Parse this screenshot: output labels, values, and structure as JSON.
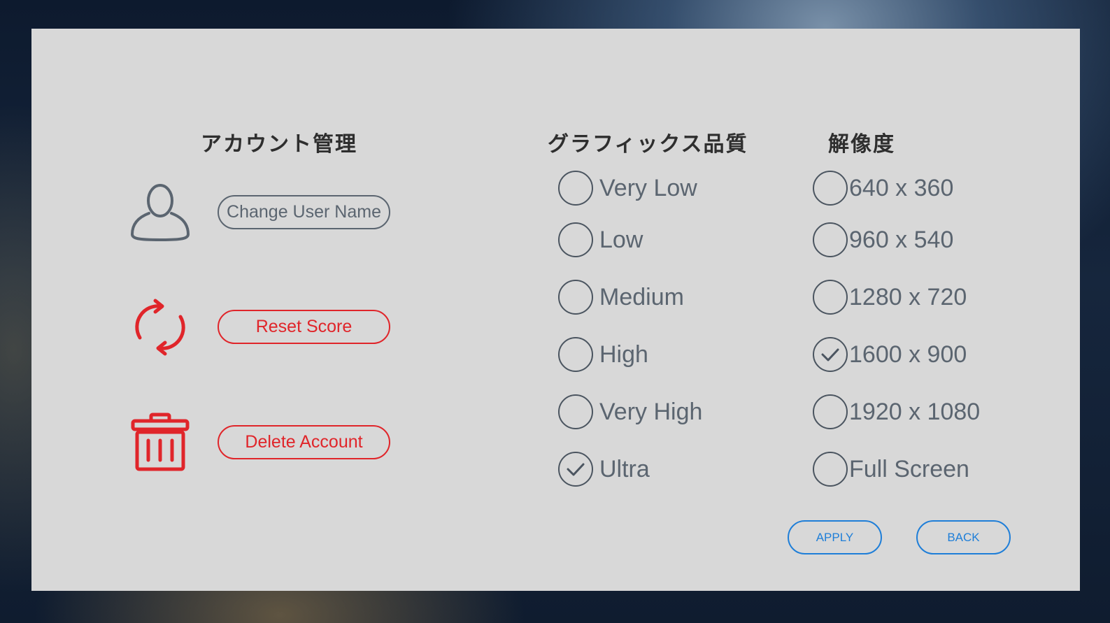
{
  "account": {
    "title": "アカウント管理",
    "actions": [
      {
        "icon": "user-icon",
        "label": "Change User Name",
        "style": "gray"
      },
      {
        "icon": "refresh-icon",
        "label": "Reset Score",
        "style": "red"
      },
      {
        "icon": "trash-icon",
        "label": "Delete Account",
        "style": "red"
      }
    ]
  },
  "graphics": {
    "title": "グラフィックス品質",
    "options": [
      {
        "label": "Very Low",
        "checked": false
      },
      {
        "label": "Low",
        "checked": false
      },
      {
        "label": "Medium",
        "checked": false
      },
      {
        "label": "High",
        "checked": false
      },
      {
        "label": "Very High",
        "checked": false
      },
      {
        "label": "Ultra",
        "checked": true
      }
    ]
  },
  "resolution": {
    "title": "解像度",
    "options": [
      {
        "label": "640 x 360",
        "checked": false
      },
      {
        "label": "960 x 540",
        "checked": false
      },
      {
        "label": "1280 x 720",
        "checked": false
      },
      {
        "label": "1600 x 900",
        "checked": true
      },
      {
        "label": "1920 x 1080",
        "checked": false
      },
      {
        "label": "Full Screen",
        "checked": false
      }
    ]
  },
  "footer": {
    "apply_label": "APPLY",
    "back_label": "BACK"
  },
  "colors": {
    "panel": "#d8d8d8",
    "heading": "#2e2e2e",
    "neutral": "#5b6570",
    "danger": "#e0252a",
    "accent": "#1e7ed8"
  }
}
